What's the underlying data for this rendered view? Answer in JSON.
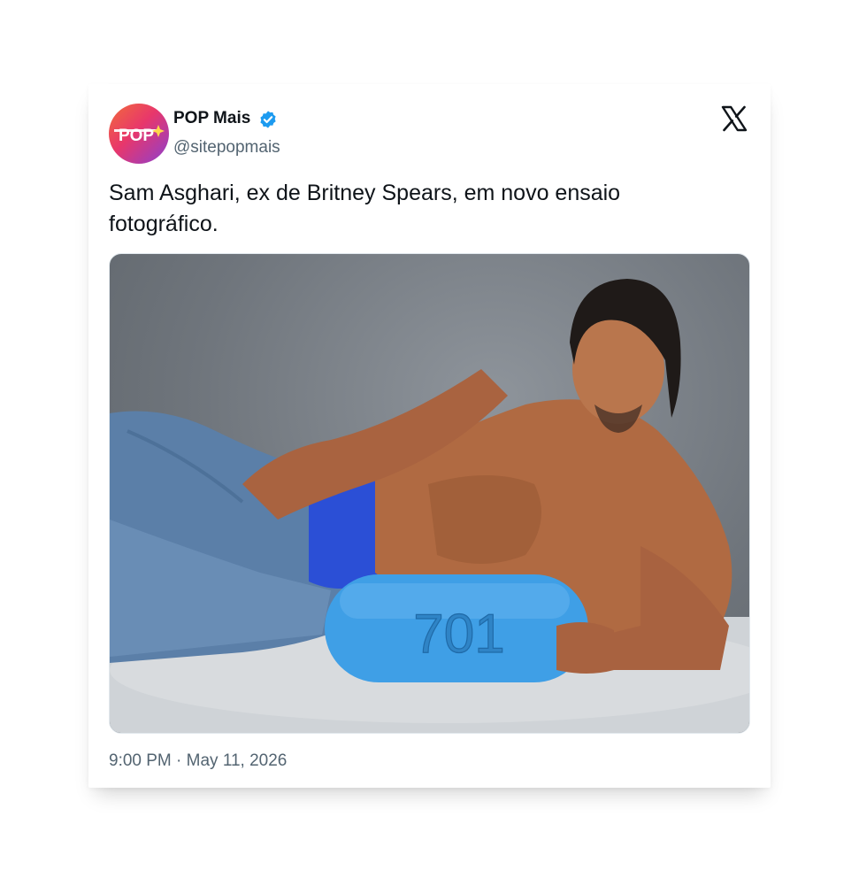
{
  "tweet": {
    "author_name": "POP Mais",
    "author_handle": "@sitepopmais",
    "avatar_text": "POP",
    "verified": true,
    "text": "Sam Asghari, ex de Britney Spears, em novo ensaio fotográfico.",
    "time": "9:00 PM",
    "separator": "·",
    "date": "May 11, 2026",
    "media": {
      "pill_text": "701"
    }
  },
  "icons": {
    "platform": "x-logo-icon",
    "verified": "verified-badge-icon"
  },
  "colors": {
    "verified_blue": "#1d9bf0",
    "secondary_text": "#536471",
    "primary_text": "#0f1419",
    "pill_blue": "#3f9fe6"
  }
}
